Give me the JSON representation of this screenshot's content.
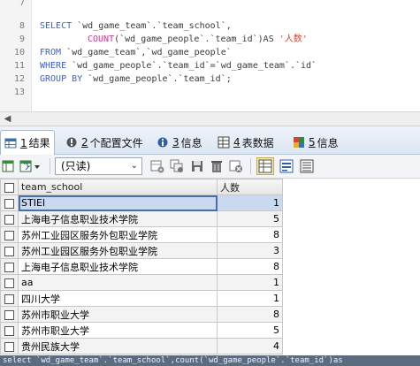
{
  "editor": {
    "line_numbers": [
      "7",
      "8",
      "9",
      "10",
      "11",
      "12",
      "13"
    ],
    "line8": {
      "kw": "SELECT",
      "rest": " `wd_game_team`.`team_school`,"
    },
    "line9": {
      "fn": "COUNT",
      "rest": "(`wd_game_people`.`team_id`)AS ",
      "str": "'人数'"
    },
    "line10": {
      "kw": "FROM",
      "rest": " `wd_game_team`,`wd_game_people`"
    },
    "line11": {
      "kw": "WHERE",
      "rest": " `wd_game_people`.`team_id`=`wd_game_team`.`id`"
    },
    "line12": {
      "kw": "GROUP BY",
      "rest": " `wd_game_people`.`team_id`;"
    }
  },
  "tabs": [
    {
      "num": "1",
      "label": "结果",
      "icon": "table-result-icon",
      "active": true
    },
    {
      "num": "2",
      "label": "个配置文件",
      "icon": "profile-icon",
      "active": false
    },
    {
      "num": "3",
      "label": "信息",
      "icon": "info-icon",
      "active": false
    },
    {
      "num": "4",
      "label": "表数据",
      "icon": "table-data-icon",
      "active": false
    },
    {
      "num": "5",
      "label": "信息",
      "icon": "info-colored-icon",
      "active": false
    }
  ],
  "toolbar": {
    "mode": "(只读)"
  },
  "grid": {
    "columns": [
      "team_school",
      "人数"
    ],
    "rows": [
      {
        "school": "STIEI",
        "count": "1"
      },
      {
        "school": "上海电子信息职业技术学院",
        "count": "5"
      },
      {
        "school": "苏州工业园区服务外包职业学院",
        "count": "8"
      },
      {
        "school": "苏州工业园区服务外包职业学院",
        "count": "3"
      },
      {
        "school": "上海电子信息职业技术学院",
        "count": "8"
      },
      {
        "school": "aa",
        "count": "1"
      },
      {
        "school": "四川大学",
        "count": "1"
      },
      {
        "school": "苏州市职业大学",
        "count": "8"
      },
      {
        "school": "苏州市职业大学",
        "count": "5"
      },
      {
        "school": "贵州民族大学",
        "count": "4"
      }
    ]
  },
  "status": {
    "text": "select `wd_game_team`.`team_school`,count(`wd_game_people`.`team_id`)as"
  },
  "colors": {
    "keyword": "#3b5fd8",
    "function": "#d1339a",
    "string": "#e03e2d",
    "selection": "#c9d9ef",
    "status_bar": "#5b6b80"
  }
}
